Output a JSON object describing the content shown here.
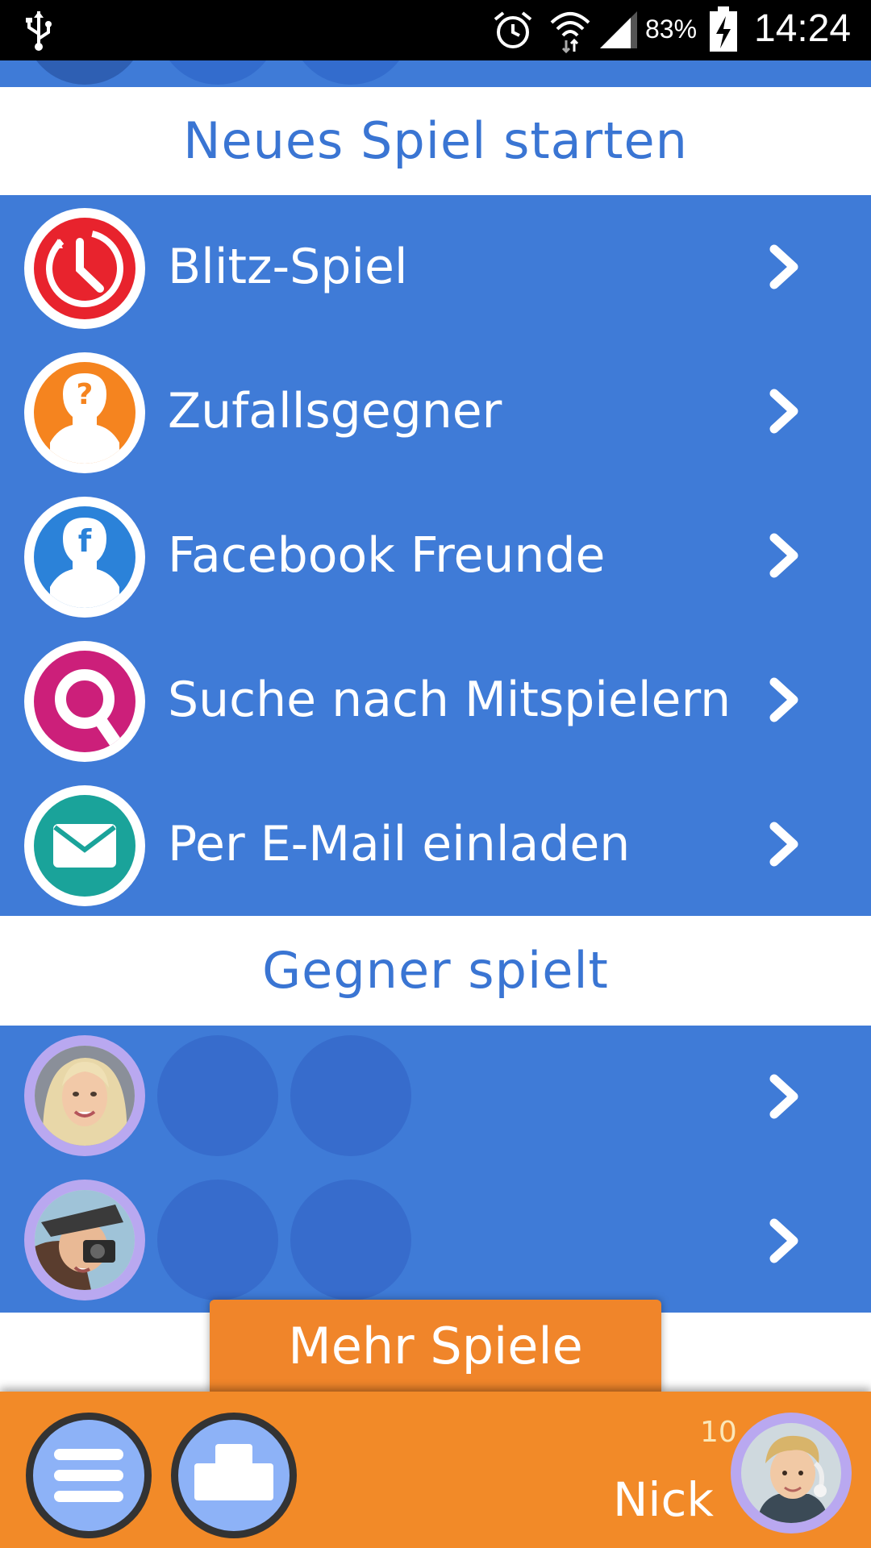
{
  "status_bar": {
    "battery_percent": "83%",
    "time": "14:24",
    "icons": [
      "usb-icon",
      "alarm-icon",
      "wifi-icon",
      "signal-icon",
      "battery-charging-icon"
    ]
  },
  "new_game": {
    "title": "Neues Spiel starten",
    "items": [
      {
        "label": "Blitz-Spiel",
        "icon": "stopwatch-icon",
        "color": "#e8232d"
      },
      {
        "label": "Zufallsgegner",
        "icon": "random-opponent-icon",
        "color": "#f5841f"
      },
      {
        "label": "Facebook Freunde",
        "icon": "facebook-friend-icon",
        "color": "#2b82d9"
      },
      {
        "label": "Suche nach Mitspielern",
        "icon": "search-icon",
        "color": "#cc1f7a"
      },
      {
        "label": "Per E-Mail einladen",
        "icon": "mail-icon",
        "color": "#1aa39a"
      }
    ]
  },
  "opponent_turn": {
    "title": "Gegner spielt",
    "games": [
      {
        "opponent_avatar": "blonde-woman-avatar"
      },
      {
        "opponent_avatar": "hat-camera-avatar"
      }
    ]
  },
  "more_games_button": "Mehr Spiele",
  "bottom_bar": {
    "user_name": "Nick",
    "user_level": "10",
    "menu_icon": "hamburger-menu-icon",
    "shop_icon": "podium-icon"
  },
  "colors": {
    "primary_blue": "#3f7bd7",
    "header_text": "#3a75d3",
    "orange": "#f28a28",
    "avatar_ring": "#b9a8f0"
  }
}
